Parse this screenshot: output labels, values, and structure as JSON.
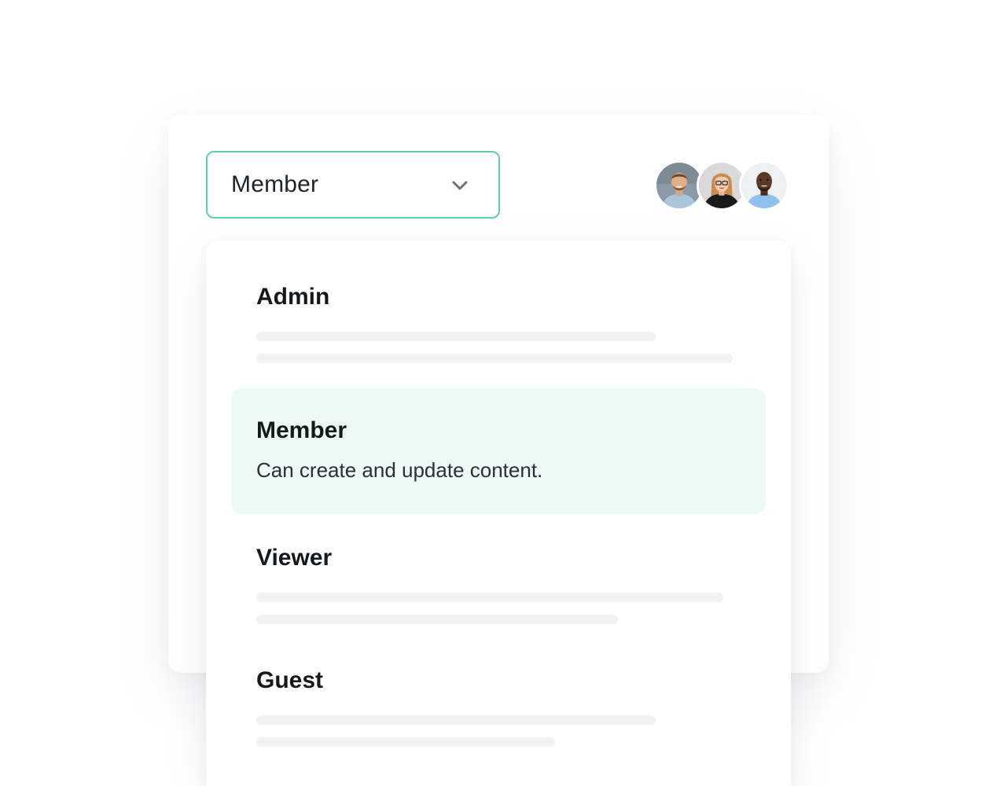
{
  "select": {
    "value": "Member",
    "icon": "chevron-down-icon"
  },
  "avatars": [
    {
      "name": "avatar-man-beard",
      "bg": "#8aa1b1",
      "skin": "#e0b08a",
      "hair": "#6b4a2e",
      "shirt": "#a9c4dd"
    },
    {
      "name": "avatar-woman-glasses",
      "bg": "#d9d9d9",
      "skin": "#f1c9ad",
      "hair": "#c98a4e",
      "shirt": "#1a1a1a"
    },
    {
      "name": "avatar-man-bald",
      "bg": "#eef0f2",
      "skin": "#5a3a26",
      "hair": "#2b1b12",
      "shirt": "#8fc1ec"
    }
  ],
  "menu": {
    "options": [
      {
        "label": "Admin",
        "description": "",
        "selected": false
      },
      {
        "label": "Member",
        "description": "Can create and update content.",
        "selected": true
      },
      {
        "label": "Viewer",
        "description": "",
        "selected": false
      },
      {
        "label": "Guest",
        "description": "",
        "selected": false
      }
    ]
  },
  "colors": {
    "accent": "#5ccfa6",
    "selected_bg": "#edf9f5",
    "skeleton": "#f0f1f3"
  }
}
